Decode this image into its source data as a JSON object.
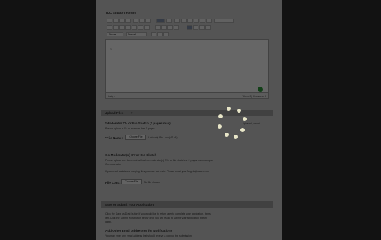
{
  "app": {
    "accent": "#2d9a3a",
    "overlay": "#000000"
  },
  "editor_section": {
    "title": "TUC Support Forum",
    "toolbar_row1": [
      "B",
      "I",
      "U",
      "ABC",
      "x²",
      "x₂",
      "Tx",
      "≡",
      "≡",
      "≡",
      "⇆",
      "🔗",
      "⛓",
      "▦",
      "Ω",
      "⟲",
      "⟳"
    ],
    "toolbar_row2": [
      "B",
      "I",
      "U",
      "S",
      "A",
      "A",
      "x",
      "≡",
      "≡",
      "≡",
      "≡",
      "▣",
      "⊞",
      "⊟",
      "⊠"
    ],
    "format_select": "Normal",
    "font_select": "Normal",
    "editor_content": "1",
    "status_left": "body p",
    "status_right": "Words: 0 | Characters: 0"
  },
  "upload_section": {
    "header": "Upload Files",
    "header_icon": "chevron-down-icon",
    "item1": {
      "heading": "*Moderator CV or Bio Sketch (1 pages max)",
      "hint": "Please upload a CV of no more than 1 pages.",
      "file_label": "*File Name:",
      "choose_button": "Choose File",
      "file_value": "Uniformly Bio...ocx (47 kB)",
      "uploaded_label": "Uploaded, deposit"
    },
    "item2": {
      "heading": "Co-Moderator(s) CV or Bio Sketch",
      "line1": "Please upload one document with all co-moderator(s) CVs or Bio sketches. 2 pages maximum per",
      "line1b": "Co-moderator.",
      "line2": "If you need assistance merging files you may ask us to. Please email your Angela@cases.edu",
      "file_label": "File Load:",
      "choose_button": "Choose File",
      "file_value": "No file chosen"
    }
  },
  "save_section": {
    "header": "Save or Submit Your Application",
    "line1": "Click the Save as Draft button if you would like to return later to complete your application. Items",
    "line2": "left. Click the Submit Now button below once you are ready to submit your application (before",
    "line3": "date).",
    "sub_heading": "Add Other Email Addresses for Notifications",
    "sub_line": "You may enter any email address that should receive a copy of the submission."
  },
  "loading": {
    "dots": 8,
    "label": "Loading"
  }
}
